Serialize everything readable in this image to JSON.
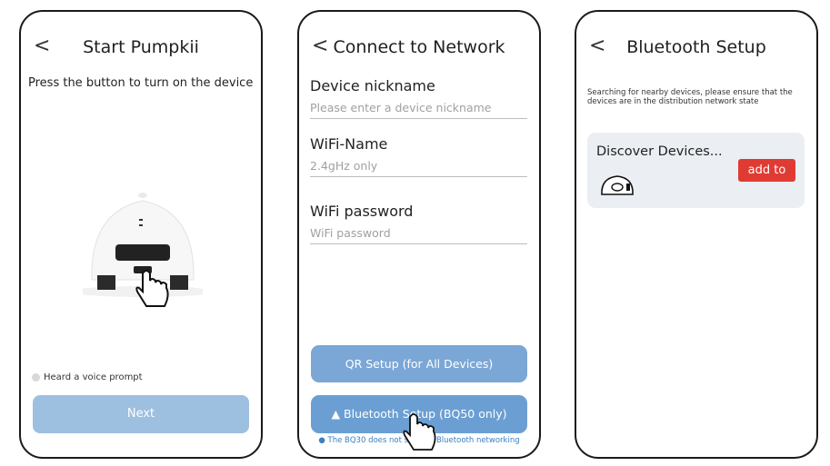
{
  "screen1": {
    "back": "<",
    "title": "Start Pumpkii",
    "instruction": "Press the button to turn on the device",
    "voice_prompt": "Heard a voice prompt",
    "next": "Next"
  },
  "screen2": {
    "back": "<",
    "title": "Connect to Network",
    "nickname_label": "Device nickname",
    "nickname_placeholder": "Please enter a device nickname",
    "wifi_name_label": "WiFi-Name",
    "wifi_name_placeholder": "2.4gHz only",
    "wifi_password_label": "WiFi password",
    "wifi_password_placeholder": "WiFi password",
    "qr_button": "QR Setup (for All Devices)",
    "bt_button": "Bluetooth Setup (BQ50 only)",
    "bt_note": "The BQ30 does not support Bluetooth networking"
  },
  "screen3": {
    "back": "<",
    "title": "Bluetooth Setup",
    "search_note": "Searching for nearby devices, please ensure that the devices are in the distribution network state",
    "discover": "Discover Devices...",
    "add": "add to"
  },
  "colors": {
    "next_button": "#9dbfe0",
    "qr_button": "#7aa7d6",
    "bt_button": "#6b9fd3",
    "add_button": "#e03b33",
    "card_bg": "#ebeef3",
    "note_blue": "#3b7fc4"
  },
  "icons": [
    "back-chevron-icon",
    "robot-illustration",
    "pointing-hand-icon",
    "robot-mini-icon",
    "radio-icon"
  ]
}
